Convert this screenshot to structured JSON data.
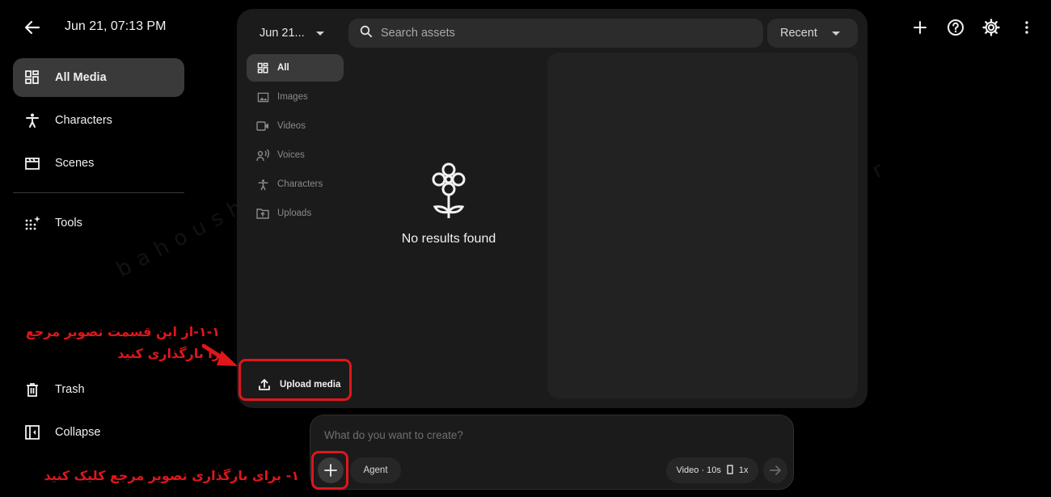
{
  "header": {
    "datetime": "Jun 21, 07:13 PM"
  },
  "sidebar": {
    "items": [
      {
        "label": "All Media",
        "icon": "grid-icon"
      },
      {
        "label": "Characters",
        "icon": "person-icon"
      },
      {
        "label": "Scenes",
        "icon": "clapperboard-icon"
      },
      {
        "label": "Tools",
        "icon": "sparkle-grid-icon"
      }
    ],
    "bottom": [
      {
        "label": "Trash",
        "icon": "trash-icon"
      },
      {
        "label": "Collapse",
        "icon": "collapse-icon"
      }
    ]
  },
  "toolbar": {
    "icons": [
      "plus-icon",
      "help-icon",
      "settings-icon",
      "more-vert-icon"
    ]
  },
  "panel": {
    "date_filter": "Jun 21...",
    "search_placeholder": "Search assets",
    "sort": "Recent",
    "filters": [
      {
        "label": "All",
        "icon": "grid-icon"
      },
      {
        "label": "Images",
        "icon": "image-icon"
      },
      {
        "label": "Videos",
        "icon": "video-icon"
      },
      {
        "label": "Voices",
        "icon": "voice-icon"
      },
      {
        "label": "Characters",
        "icon": "person-icon"
      },
      {
        "label": "Uploads",
        "icon": "upload-folder-icon"
      }
    ],
    "empty_message": "No results found",
    "upload_label": "Upload media"
  },
  "composer": {
    "placeholder": "What do you want to create?",
    "agent_label": "Agent",
    "settings_label": "Video · 10s",
    "speed_label": "1x"
  },
  "annotations": {
    "note_upload": "۱-۱-از این قسمت تصویر مرجع\nرا بارگذاری کنید",
    "note_add": "۱- برای بارگذاری تصویر مرجع کلیک کنید",
    "watermark": "bahoushai.ir",
    "color": "#e0161b"
  }
}
